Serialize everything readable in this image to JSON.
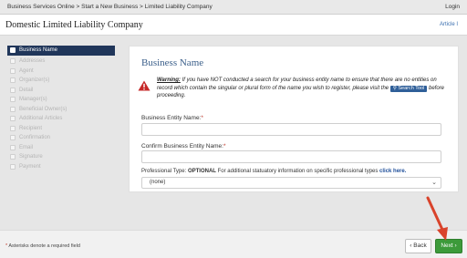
{
  "topbar": {
    "breadcrumb": "Business Services Online > Start a New Business > Limited Liability Company",
    "login": "Login"
  },
  "header": {
    "title": "Domestic Limited Liability Company",
    "article_link": "Article I"
  },
  "sidebar": {
    "items": [
      {
        "label": "Business Name",
        "active": true
      },
      {
        "label": "Addresses"
      },
      {
        "label": "Agent"
      },
      {
        "label": "Organizer(s)"
      },
      {
        "label": "Detail"
      },
      {
        "label": "Manager(s)"
      },
      {
        "label": "Beneficial Owner(s)"
      },
      {
        "label": "Additional Articles"
      },
      {
        "label": "Recipient"
      },
      {
        "label": "Confirmation"
      },
      {
        "label": "Email"
      },
      {
        "label": "Signature"
      },
      {
        "label": "Payment"
      }
    ]
  },
  "main": {
    "heading": "Business Name",
    "warning": {
      "label": "Warning:",
      "text_before": "If you have NOT conducted a search for your business entity name to ensure that there are no entities on record which contain the singular or plural form of the name you wish to register, please visit the",
      "button": "Search Tool",
      "text_after": "before proceeding."
    },
    "fields": {
      "entity_name_label": "Business Entity Name:",
      "confirm_name_label": "Confirm Business Entity Name:",
      "required_mark": "*"
    },
    "professional": {
      "label_start": "Professional Type:",
      "optional": "OPTIONAL",
      "label_mid": "For additional statuatory information on specific professional types",
      "link": "click here.",
      "selected": "(none)"
    }
  },
  "footer": {
    "required_mark": "*",
    "note": "Asterisks denote a required field",
    "back_label": "Back",
    "next_label": "Next"
  },
  "colors": {
    "nav_active": "#20365a",
    "heading": "#3b5f8a",
    "next_button": "#3c9a3a",
    "required": "#c0392b",
    "annotation_arrow": "#d9432b"
  },
  "icons": {
    "warning": "warning-triangle-icon",
    "search": "search-icon",
    "back": "chevron-left-icon",
    "next": "chevron-right-icon",
    "select": "chevron-down-icon"
  }
}
